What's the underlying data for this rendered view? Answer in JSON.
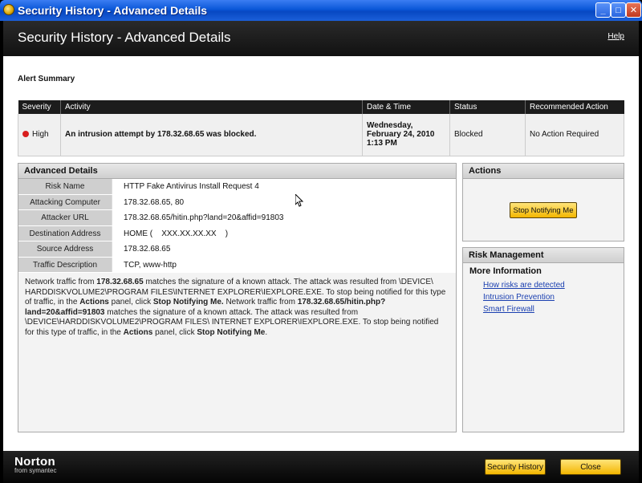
{
  "window": {
    "title": "Security History - Advanced Details",
    "min_glyph": "_",
    "max_glyph": "□",
    "close_glyph": "✕"
  },
  "header": {
    "title": "Security History - Advanced Details",
    "help_label": "Help"
  },
  "alert_summary": {
    "heading": "Alert Summary",
    "columns": [
      "Severity",
      "Activity",
      "Date & Time",
      "Status",
      "Recommended Action"
    ],
    "row": {
      "severity": "High",
      "severity_color": "#d81e1e",
      "activity": "An intrusion attempt by 178.32.68.65 was blocked.",
      "date_line1": "Wednesday,",
      "date_line2": "February 24, 2010",
      "date_line3": "1:13 PM",
      "status": "Blocked",
      "recommended_action": "No Action Required"
    }
  },
  "advanced_details": {
    "heading": "Advanced Details",
    "rows": [
      {
        "label": "Risk Name",
        "value": "HTTP Fake Antivirus Install Request 4"
      },
      {
        "label": "Attacking Computer",
        "value": "178.32.68.65, 80"
      },
      {
        "label": "Attacker URL",
        "value": "178.32.68.65/hitin.php?land=20&affid=91803"
      },
      {
        "label": "Destination Address",
        "value": "HOME (    XXX.XX.XX.XX    )"
      },
      {
        "label": "Source Address",
        "value": "178.32.68.65"
      },
      {
        "label": "Traffic Description",
        "value": "TCP, www-http"
      }
    ],
    "description": {
      "p1": "Network traffic from ",
      "b1": "178.32.68.65",
      "p2": " matches the signature of a known attack. The attack was resulted from \\DEVICE\\ HARDDISKVOLUME2\\PROGRAM FILES\\INTERNET EXPLORER\\IEXPLORE.EXE. To stop being notified for this type of traffic, in the ",
      "b2": "Actions",
      "p3": " panel, click ",
      "b3": "Stop Notifying Me.",
      "p4": " Network traffic from ",
      "b4": "178.32.68.65/hitin.php?land=20&affid=91803",
      "p5": " matches the signature of a known attack. The attack was resulted from \\DEVICE\\HARDDISKVOLUME2\\PROGRAM FILES\\ INTERNET EXPLORER\\IEXPLORE.EXE. To stop being notified for this type of traffic, in the ",
      "b5": "Actions",
      "p6": " panel, click ",
      "b6": "Stop Notifying Me",
      "p7": "."
    }
  },
  "actions": {
    "heading": "Actions",
    "stop_button": "Stop Notifying Me"
  },
  "risk_management": {
    "heading": "Risk Management",
    "more_info": "More Information",
    "links": [
      "How risks are detected",
      "Intrusion Prevention",
      "Smart Firewall"
    ]
  },
  "footer": {
    "brand": "Norton",
    "brand_sub": "from symantec",
    "history_button": "Security History",
    "close_button": "Close"
  }
}
